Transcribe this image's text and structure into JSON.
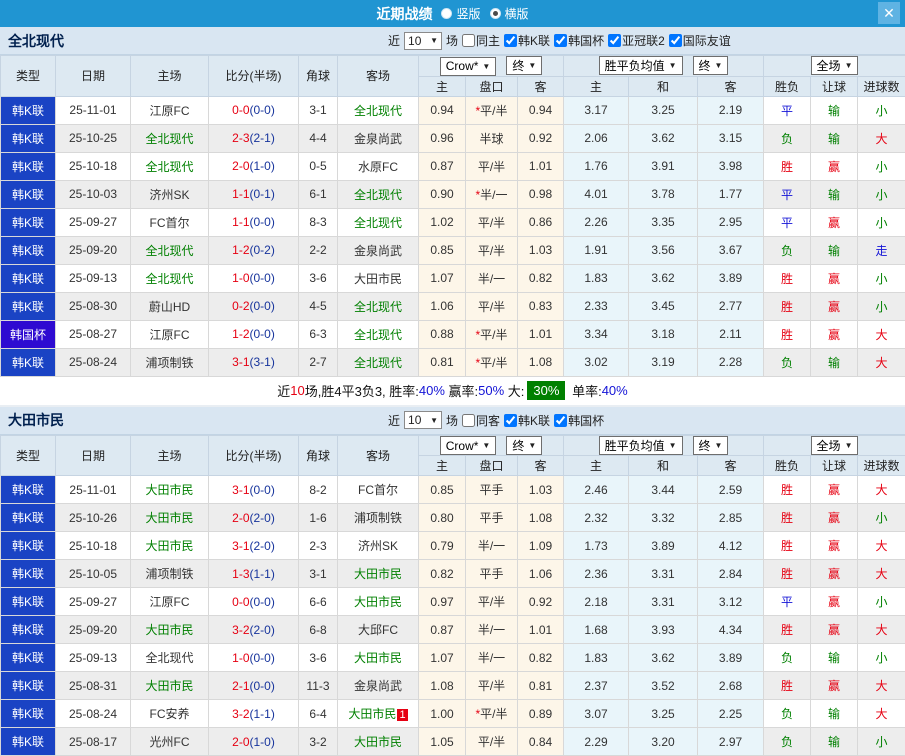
{
  "titlebar": {
    "title": "近期战绩",
    "view_options": [
      {
        "label": "竖版",
        "selected": false
      },
      {
        "label": "横版",
        "selected": true
      }
    ],
    "close_glyph": "✕",
    "bar_color": "#2095d2"
  },
  "labels": {
    "near": "近",
    "games": "场",
    "select_arrow": "▼"
  },
  "header": {
    "type": "类型",
    "date": "日期",
    "home": "主场",
    "score": "比分(半场)",
    "corner": "角球",
    "away": "客场",
    "bookmaker_select": "Crow*",
    "final_select": "终",
    "avg_select": "胜平负均值",
    "fulltime_select": "全场",
    "h": "主",
    "handicap": "盘口",
    "a": "客",
    "avg_h": "主",
    "avg_d": "和",
    "avg_a": "客",
    "wdl": "胜负",
    "handicap_result": "让球",
    "goals": "进球数"
  },
  "colors": {
    "titlebar": "#2095d2",
    "league_cell": "#1a43c4",
    "cup_cell": "#2e0bd1",
    "win": "#e60012",
    "lose": "#008000",
    "draw": "#1313d6",
    "featured_team": "#008000",
    "score_fulltime": "#e60012",
    "score_halftime": "#17349c",
    "odds_bg": "#fdf6e9",
    "avg_bg": "#e9f5fa",
    "summary_badge_bg": "#008000"
  },
  "sections": [
    {
      "team": "全北现代",
      "match_count": "10",
      "filters": [
        {
          "label": "同主",
          "checked": false
        },
        {
          "label": "韩K联",
          "checked": true
        },
        {
          "label": "韩国杯",
          "checked": true
        },
        {
          "label": "亚冠联2",
          "checked": true
        },
        {
          "label": "国际友谊",
          "checked": true
        }
      ],
      "rows": [
        {
          "lg": "韩K联",
          "cup": false,
          "date": "25-11-01",
          "home": "江原FC",
          "hf": false,
          "ft": "0-0",
          "ht": "(0-0)",
          "cn": "3-1",
          "away": "全北现代",
          "af": true,
          "badge": "",
          "o1": "0.94",
          "st": true,
          "hc": "平/半",
          "o2": "0.94",
          "m1": "3.17",
          "m2": "3.25",
          "m3": "2.19",
          "r1": [
            "平",
            "blue"
          ],
          "r2": [
            "输",
            "green"
          ],
          "r3": [
            "小",
            "green"
          ]
        },
        {
          "lg": "韩K联",
          "cup": false,
          "date": "25-10-25",
          "home": "全北现代",
          "hf": true,
          "ft": "2-3",
          "ht": "(2-1)",
          "cn": "4-4",
          "away": "金泉尚武",
          "af": false,
          "badge": "",
          "o1": "0.96",
          "st": false,
          "hc": "半球",
          "o2": "0.92",
          "m1": "2.06",
          "m2": "3.62",
          "m3": "3.15",
          "r1": [
            "负",
            "green"
          ],
          "r2": [
            "输",
            "green"
          ],
          "r3": [
            "大",
            "red"
          ]
        },
        {
          "lg": "韩K联",
          "cup": false,
          "date": "25-10-18",
          "home": "全北现代",
          "hf": true,
          "ft": "2-0",
          "ht": "(1-0)",
          "cn": "0-5",
          "away": "水原FC",
          "af": false,
          "badge": "",
          "o1": "0.87",
          "st": false,
          "hc": "平/半",
          "o2": "1.01",
          "m1": "1.76",
          "m2": "3.91",
          "m3": "3.98",
          "r1": [
            "胜",
            "red"
          ],
          "r2": [
            "赢",
            "red"
          ],
          "r3": [
            "小",
            "green"
          ]
        },
        {
          "lg": "韩K联",
          "cup": false,
          "date": "25-10-03",
          "home": "济州SK",
          "hf": false,
          "ft": "1-1",
          "ht": "(0-1)",
          "cn": "6-1",
          "away": "全北现代",
          "af": true,
          "badge": "",
          "o1": "0.90",
          "st": true,
          "hc": "半/一",
          "o2": "0.98",
          "m1": "4.01",
          "m2": "3.78",
          "m3": "1.77",
          "r1": [
            "平",
            "blue"
          ],
          "r2": [
            "输",
            "green"
          ],
          "r3": [
            "小",
            "green"
          ]
        },
        {
          "lg": "韩K联",
          "cup": false,
          "date": "25-09-27",
          "home": "FC首尔",
          "hf": false,
          "ft": "1-1",
          "ht": "(0-0)",
          "cn": "8-3",
          "away": "全北现代",
          "af": true,
          "badge": "",
          "o1": "1.02",
          "st": false,
          "hc": "平/半",
          "o2": "0.86",
          "m1": "2.26",
          "m2": "3.35",
          "m3": "2.95",
          "r1": [
            "平",
            "blue"
          ],
          "r2": [
            "赢",
            "red"
          ],
          "r3": [
            "小",
            "green"
          ]
        },
        {
          "lg": "韩K联",
          "cup": false,
          "date": "25-09-20",
          "home": "全北现代",
          "hf": true,
          "ft": "1-2",
          "ht": "(0-2)",
          "cn": "2-2",
          "away": "金泉尚武",
          "af": false,
          "badge": "",
          "o1": "0.85",
          "st": false,
          "hc": "平/半",
          "o2": "1.03",
          "m1": "1.91",
          "m2": "3.56",
          "m3": "3.67",
          "r1": [
            "负",
            "green"
          ],
          "r2": [
            "输",
            "green"
          ],
          "r3": [
            "走",
            "blue"
          ]
        },
        {
          "lg": "韩K联",
          "cup": false,
          "date": "25-09-13",
          "home": "全北现代",
          "hf": true,
          "ft": "1-0",
          "ht": "(0-0)",
          "cn": "3-6",
          "away": "大田市民",
          "af": false,
          "badge": "",
          "o1": "1.07",
          "st": false,
          "hc": "半/一",
          "o2": "0.82",
          "m1": "1.83",
          "m2": "3.62",
          "m3": "3.89",
          "r1": [
            "胜",
            "red"
          ],
          "r2": [
            "赢",
            "red"
          ],
          "r3": [
            "小",
            "green"
          ]
        },
        {
          "lg": "韩K联",
          "cup": false,
          "date": "25-08-30",
          "home": "蔚山HD",
          "hf": false,
          "ft": "0-2",
          "ht": "(0-0)",
          "cn": "4-5",
          "away": "全北现代",
          "af": true,
          "badge": "",
          "o1": "1.06",
          "st": false,
          "hc": "平/半",
          "o2": "0.83",
          "m1": "2.33",
          "m2": "3.45",
          "m3": "2.77",
          "r1": [
            "胜",
            "red"
          ],
          "r2": [
            "赢",
            "red"
          ],
          "r3": [
            "小",
            "green"
          ]
        },
        {
          "lg": "韩国杯",
          "cup": true,
          "date": "25-08-27",
          "home": "江原FC",
          "hf": false,
          "ft": "1-2",
          "ht": "(0-0)",
          "cn": "6-3",
          "away": "全北现代",
          "af": true,
          "badge": "",
          "o1": "0.88",
          "st": true,
          "hc": "平/半",
          "o2": "1.01",
          "m1": "3.34",
          "m2": "3.18",
          "m3": "2.11",
          "r1": [
            "胜",
            "red"
          ],
          "r2": [
            "赢",
            "red"
          ],
          "r3": [
            "大",
            "red"
          ]
        },
        {
          "lg": "韩K联",
          "cup": false,
          "date": "25-08-24",
          "home": "浦项制铁",
          "hf": false,
          "ft": "3-1",
          "ht": "(3-1)",
          "cn": "2-7",
          "away": "全北现代",
          "af": true,
          "badge": "",
          "o1": "0.81",
          "st": true,
          "hc": "平/半",
          "o2": "1.08",
          "m1": "3.02",
          "m2": "3.19",
          "m3": "2.28",
          "r1": [
            "负",
            "green"
          ],
          "r2": [
            "输",
            "green"
          ],
          "r3": [
            "大",
            "red"
          ]
        }
      ],
      "summary": [
        [
          "近",
          ""
        ],
        [
          "10",
          "red"
        ],
        [
          "场,胜4平3负3, 胜率:",
          ""
        ],
        [
          "40%",
          "blue"
        ],
        [
          " 赢率:",
          ""
        ],
        [
          "50%",
          "blue"
        ],
        [
          " 大:",
          ""
        ],
        [
          "30%",
          "badge"
        ],
        [
          " 单率:",
          ""
        ],
        [
          "40%",
          "blue"
        ]
      ]
    },
    {
      "team": "大田市民",
      "match_count": "10",
      "filters": [
        {
          "label": "同客",
          "checked": false
        },
        {
          "label": "韩K联",
          "checked": true
        },
        {
          "label": "韩国杯",
          "checked": true
        }
      ],
      "rows": [
        {
          "lg": "韩K联",
          "cup": false,
          "date": "25-11-01",
          "home": "大田市民",
          "hf": true,
          "ft": "3-1",
          "ht": "(0-0)",
          "cn": "8-2",
          "away": "FC首尔",
          "af": false,
          "badge": "",
          "o1": "0.85",
          "st": false,
          "hc": "平手",
          "o2": "1.03",
          "m1": "2.46",
          "m2": "3.44",
          "m3": "2.59",
          "r1": [
            "胜",
            "red"
          ],
          "r2": [
            "赢",
            "red"
          ],
          "r3": [
            "大",
            "red"
          ]
        },
        {
          "lg": "韩K联",
          "cup": false,
          "date": "25-10-26",
          "home": "大田市民",
          "hf": true,
          "ft": "2-0",
          "ht": "(2-0)",
          "cn": "1-6",
          "away": "浦项制铁",
          "af": false,
          "badge": "",
          "o1": "0.80",
          "st": false,
          "hc": "平手",
          "o2": "1.08",
          "m1": "2.32",
          "m2": "3.32",
          "m3": "2.85",
          "r1": [
            "胜",
            "red"
          ],
          "r2": [
            "赢",
            "red"
          ],
          "r3": [
            "小",
            "green"
          ]
        },
        {
          "lg": "韩K联",
          "cup": false,
          "date": "25-10-18",
          "home": "大田市民",
          "hf": true,
          "ft": "3-1",
          "ht": "(2-0)",
          "cn": "2-3",
          "away": "济州SK",
          "af": false,
          "badge": "",
          "o1": "0.79",
          "st": false,
          "hc": "半/一",
          "o2": "1.09",
          "m1": "1.73",
          "m2": "3.89",
          "m3": "4.12",
          "r1": [
            "胜",
            "red"
          ],
          "r2": [
            "赢",
            "red"
          ],
          "r3": [
            "大",
            "red"
          ]
        },
        {
          "lg": "韩K联",
          "cup": false,
          "date": "25-10-05",
          "home": "浦项制铁",
          "hf": false,
          "ft": "1-3",
          "ht": "(1-1)",
          "cn": "3-1",
          "away": "大田市民",
          "af": true,
          "badge": "",
          "o1": "0.82",
          "st": false,
          "hc": "平手",
          "o2": "1.06",
          "m1": "2.36",
          "m2": "3.31",
          "m3": "2.84",
          "r1": [
            "胜",
            "red"
          ],
          "r2": [
            "赢",
            "red"
          ],
          "r3": [
            "大",
            "red"
          ]
        },
        {
          "lg": "韩K联",
          "cup": false,
          "date": "25-09-27",
          "home": "江原FC",
          "hf": false,
          "ft": "0-0",
          "ht": "(0-0)",
          "cn": "6-6",
          "away": "大田市民",
          "af": true,
          "badge": "",
          "o1": "0.97",
          "st": false,
          "hc": "平/半",
          "o2": "0.92",
          "m1": "2.18",
          "m2": "3.31",
          "m3": "3.12",
          "r1": [
            "平",
            "blue"
          ],
          "r2": [
            "赢",
            "red"
          ],
          "r3": [
            "小",
            "green"
          ]
        },
        {
          "lg": "韩K联",
          "cup": false,
          "date": "25-09-20",
          "home": "大田市民",
          "hf": true,
          "ft": "3-2",
          "ht": "(2-0)",
          "cn": "6-8",
          "away": "大邱FC",
          "af": false,
          "badge": "",
          "o1": "0.87",
          "st": false,
          "hc": "半/一",
          "o2": "1.01",
          "m1": "1.68",
          "m2": "3.93",
          "m3": "4.34",
          "r1": [
            "胜",
            "red"
          ],
          "r2": [
            "赢",
            "red"
          ],
          "r3": [
            "大",
            "red"
          ]
        },
        {
          "lg": "韩K联",
          "cup": false,
          "date": "25-09-13",
          "home": "全北现代",
          "hf": false,
          "ft": "1-0",
          "ht": "(0-0)",
          "cn": "3-6",
          "away": "大田市民",
          "af": true,
          "badge": "",
          "o1": "1.07",
          "st": false,
          "hc": "半/一",
          "o2": "0.82",
          "m1": "1.83",
          "m2": "3.62",
          "m3": "3.89",
          "r1": [
            "负",
            "green"
          ],
          "r2": [
            "输",
            "green"
          ],
          "r3": [
            "小",
            "green"
          ]
        },
        {
          "lg": "韩K联",
          "cup": false,
          "date": "25-08-31",
          "home": "大田市民",
          "hf": true,
          "ft": "2-1",
          "ht": "(0-0)",
          "cn": "11-3",
          "away": "金泉尚武",
          "af": false,
          "badge": "",
          "o1": "1.08",
          "st": false,
          "hc": "平/半",
          "o2": "0.81",
          "m1": "2.37",
          "m2": "3.52",
          "m3": "2.68",
          "r1": [
            "胜",
            "red"
          ],
          "r2": [
            "赢",
            "red"
          ],
          "r3": [
            "大",
            "red"
          ]
        },
        {
          "lg": "韩K联",
          "cup": false,
          "date": "25-08-24",
          "home": "FC安养",
          "hf": false,
          "ft": "3-2",
          "ht": "(1-1)",
          "cn": "6-4",
          "away": "大田市民",
          "af": true,
          "badge": "1",
          "o1": "1.00",
          "st": true,
          "hc": "平/半",
          "o2": "0.89",
          "m1": "3.07",
          "m2": "3.25",
          "m3": "2.25",
          "r1": [
            "负",
            "green"
          ],
          "r2": [
            "输",
            "green"
          ],
          "r3": [
            "大",
            "red"
          ]
        },
        {
          "lg": "韩K联",
          "cup": false,
          "date": "25-08-17",
          "home": "光州FC",
          "hf": false,
          "ft": "2-0",
          "ht": "(1-0)",
          "cn": "3-2",
          "away": "大田市民",
          "af": true,
          "badge": "",
          "o1": "1.05",
          "st": false,
          "hc": "平/半",
          "o2": "0.84",
          "m1": "2.29",
          "m2": "3.20",
          "m3": "2.97",
          "r1": [
            "负",
            "green"
          ],
          "r2": [
            "输",
            "green"
          ],
          "r3": [
            "小",
            "green"
          ]
        }
      ],
      "summary": null
    }
  ]
}
